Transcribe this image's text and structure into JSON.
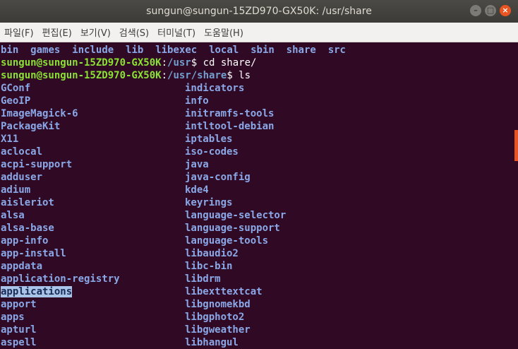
{
  "window": {
    "title": "sungun@sungun-15ZD970-GX50K: /usr/share",
    "buttons": {
      "minimize": "–",
      "maximize": "□",
      "close": "×"
    }
  },
  "menu": [
    "파일(F)",
    "편집(E)",
    "보기(V)",
    "검색(S)",
    "터미널(T)",
    "도움말(H)"
  ],
  "terminal": {
    "usr_listing": [
      "bin",
      "games",
      "include",
      "lib",
      "libexec",
      "local",
      "sbin",
      "share",
      "src"
    ],
    "prompt1": {
      "user": "sungun@sungun-15ZD970-GX50K",
      "sep": ":",
      "path": "/usr",
      "sym": "$ ",
      "cmd": "cd share/"
    },
    "prompt2": {
      "user": "sungun@sungun-15ZD970-GX50K",
      "sep": ":",
      "path": "/usr/share",
      "sym": "$ ",
      "cmd": "ls"
    },
    "col1": [
      "GConf",
      "GeoIP",
      "ImageMagick-6",
      "PackageKit",
      "X11",
      "aclocal",
      "acpi-support",
      "adduser",
      "adium",
      "aisleriot",
      "alsa",
      "alsa-base",
      "app-info",
      "app-install",
      "appdata",
      "application-registry",
      "applications",
      "apport",
      "apps",
      "apturl",
      "aspell"
    ],
    "col2": [
      "indicators",
      "info",
      "initramfs-tools",
      "intltool-debian",
      "iptables",
      "iso-codes",
      "java",
      "java-config",
      "kde4",
      "keyrings",
      "language-selector",
      "language-support",
      "language-tools",
      "libaudio2",
      "libc-bin",
      "libdrm",
      "libexttextcat",
      "libgnomekbd",
      "libgphoto2",
      "libgweather",
      "libhangul"
    ],
    "selected": "applications"
  }
}
